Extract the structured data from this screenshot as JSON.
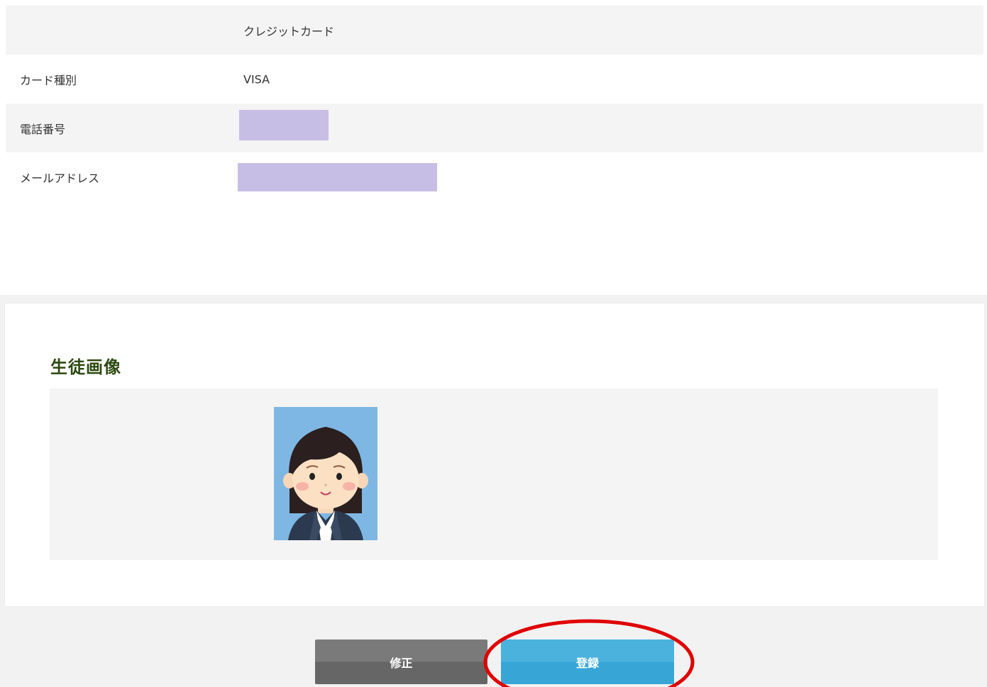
{
  "payment_method_value": "クレジットカード",
  "rows": [
    {
      "label": "カード種別",
      "value": "VISA"
    },
    {
      "label": "電話番号",
      "value": ""
    },
    {
      "label": "メールアドレス",
      "value": ""
    }
  ],
  "photo_section": {
    "title": "生徒画像",
    "photo_alt": "student-photo"
  },
  "buttons": {
    "edit_label": "修正",
    "register_label": "登録"
  },
  "colors": {
    "redaction": "#c7bee5",
    "edit_button": "#707070",
    "register_button": "#40acda",
    "section_title": "#2e4a12",
    "highlight": "#e00000"
  }
}
